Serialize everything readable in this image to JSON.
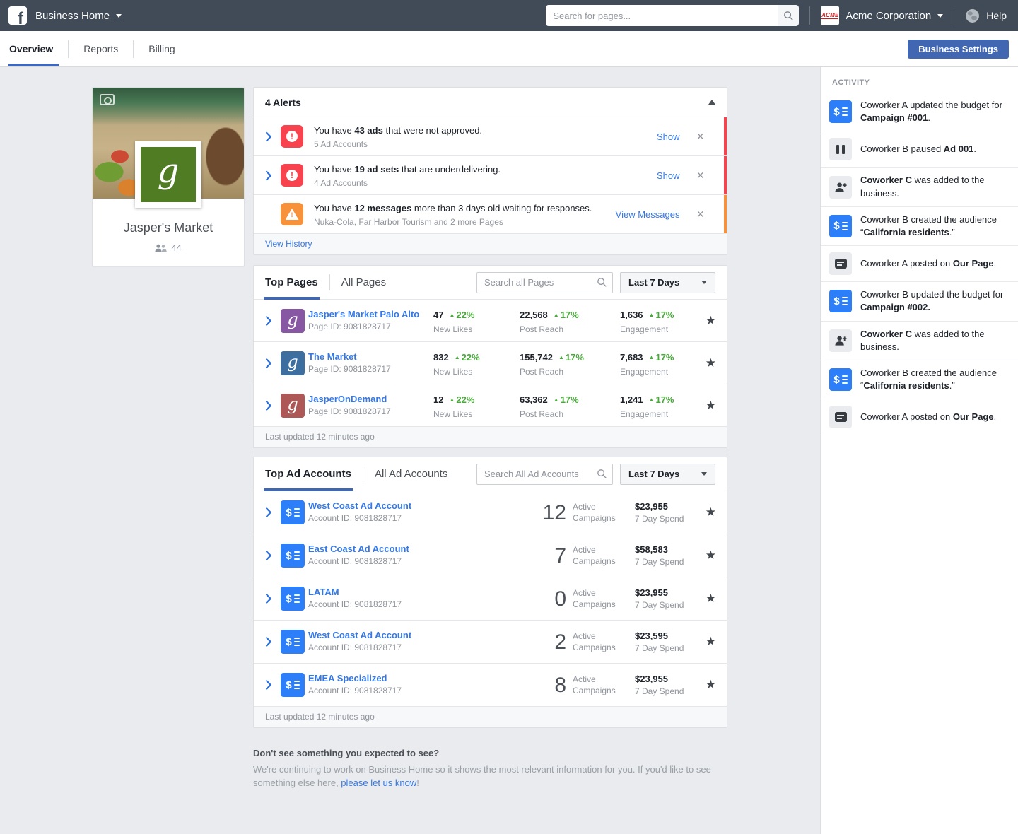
{
  "topbar": {
    "logo_letter": "f",
    "app_title": "Business Home",
    "search_placeholder": "Search for pages...",
    "business_logo_text": "ACME",
    "business_name": "Acme Corporation",
    "help_label": "Help"
  },
  "nav": {
    "tabs": [
      "Overview",
      "Reports",
      "Billing"
    ],
    "active_tab": "Overview",
    "settings_button": "Business Settings"
  },
  "profile_card": {
    "logo_letter": "g",
    "name": "Jasper's Market",
    "members_count": "44"
  },
  "alerts": {
    "title": "4 Alerts",
    "items": [
      {
        "severity": "error",
        "chevron": true,
        "pre": "You have ",
        "bold": "43 ads",
        "post": " that were not approved.",
        "subtext": "5 Ad Accounts",
        "action": "Show"
      },
      {
        "severity": "error",
        "chevron": true,
        "pre": "You have ",
        "bold": "19 ad sets",
        "post": " that are underdelivering.",
        "subtext": "4 Ad Accounts",
        "action": "Show"
      },
      {
        "severity": "warning",
        "chevron": false,
        "pre": "You have ",
        "bold": "12 messages",
        "post": " more than 3 days old waiting for responses.",
        "subtext": "Nuka-Cola, Far Harbor Tourism and 2 more Pages",
        "action": "View Messages"
      }
    ],
    "footer_link": "View History"
  },
  "pages_section": {
    "tabs": [
      "Top Pages",
      "All Pages"
    ],
    "search_placeholder": "Search all Pages",
    "range_selector": "Last 7 Days",
    "rows": [
      {
        "name": "Jasper's Market Palo Alto",
        "id_label": "Page ID: 9081828717",
        "icon_color": "#8757a3",
        "icon_letter": "g",
        "stats": [
          {
            "value": "47",
            "delta": "22%",
            "label": "New Likes"
          },
          {
            "value": "22,568",
            "delta": "17%",
            "label": "Post Reach"
          },
          {
            "value": "1,636",
            "delta": "17%",
            "label": "Engagement"
          }
        ]
      },
      {
        "name": "The Market",
        "id_label": "Page ID: 9081828717",
        "icon_color": "#3c6f9f",
        "icon_letter": "g",
        "stats": [
          {
            "value": "832",
            "delta": "22%",
            "label": "New Likes"
          },
          {
            "value": "155,742",
            "delta": "17%",
            "label": "Post Reach"
          },
          {
            "value": "7,683",
            "delta": "17%",
            "label": "Engagement"
          }
        ]
      },
      {
        "name": "JasperOnDemand",
        "id_label": "Page ID: 9081828717",
        "icon_color": "#ae5757",
        "icon_letter": "g",
        "stats": [
          {
            "value": "12",
            "delta": "22%",
            "label": "New Likes"
          },
          {
            "value": "63,362",
            "delta": "17%",
            "label": "Post Reach"
          },
          {
            "value": "1,241",
            "delta": "17%",
            "label": "Engagement"
          }
        ]
      }
    ],
    "footer": "Last updated 12 minutes ago"
  },
  "ad_accounts_section": {
    "tabs": [
      "Top Ad Accounts",
      "All Ad Accounts"
    ],
    "search_placeholder": "Search All Ad Accounts",
    "range_selector": "Last 7 Days",
    "campaigns_label": "Active Campaigns",
    "spend_label": "7 Day Spend",
    "rows": [
      {
        "name": "West Coast Ad Account",
        "id_label": "Account ID: 9081828717",
        "campaigns": "12",
        "spend": "$23,955"
      },
      {
        "name": "East Coast Ad Account",
        "id_label": "Account ID: 9081828717",
        "campaigns": "7",
        "spend": "$58,583"
      },
      {
        "name": "LATAM",
        "id_label": "Account ID: 9081828717",
        "campaigns": "0",
        "spend": "$23,955"
      },
      {
        "name": "West Coast Ad Account",
        "id_label": "Account ID: 9081828717",
        "campaigns": "2",
        "spend": "$23,595"
      },
      {
        "name": "EMEA Specialized",
        "id_label": "Account ID: 9081828717",
        "campaigns": "8",
        "spend": "$23,955"
      }
    ],
    "footer": "Last updated 12 minutes ago"
  },
  "feedback": {
    "title": "Don't see something you expected to see?",
    "body_pre": "We're continuing to work on Business Home so it shows the most relevant information for you. If you'd like to see something else here, ",
    "link": "please let us know",
    "body_post": "!"
  },
  "activity": {
    "title": "ACTIVITY",
    "items": [
      {
        "icon": "money",
        "pre": "Coworker A updated the budget for ",
        "bold": "Campaign #001",
        "post": "."
      },
      {
        "icon": "pause",
        "pre": "Coworker B paused ",
        "bold": "Ad 001",
        "post": "."
      },
      {
        "icon": "person-add",
        "pre": "",
        "bold": "Coworker C",
        "post": " was added to the business."
      },
      {
        "icon": "money",
        "pre": "Coworker B created the audience “",
        "bold": "California residents",
        "post": ".”"
      },
      {
        "icon": "post",
        "pre": "Coworker A posted on ",
        "bold": "Our Page",
        "post": "."
      },
      {
        "icon": "money",
        "pre": "Coworker B updated the budget for ",
        "bold": "Campaign #002.",
        "post": ""
      },
      {
        "icon": "person-add",
        "pre": "",
        "bold": "Coworker C",
        "post": " was added to the business."
      },
      {
        "icon": "money",
        "pre": "Coworker B created the audience “",
        "bold": "California residents",
        "post": ".”"
      },
      {
        "icon": "post",
        "pre": "Coworker A posted on ",
        "bold": "Our Page",
        "post": "."
      }
    ]
  },
  "colors": {
    "topbar": "#414b57",
    "accent_blue": "#4267b2",
    "link_blue": "#3578e5",
    "green": "#4aa83c",
    "alert_red": "#f8434f",
    "alert_orange": "#f7923b",
    "money_icon_blue": "#2d7ff9",
    "page_bg": "#e9ebee"
  }
}
